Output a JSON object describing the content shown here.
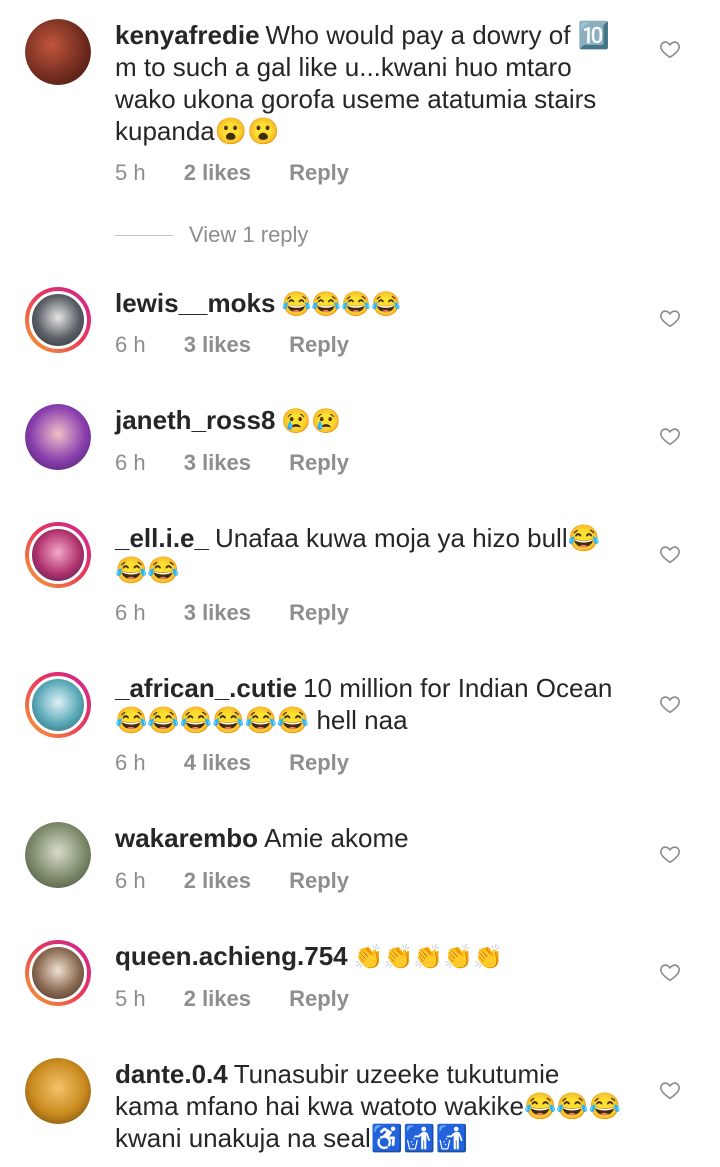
{
  "comments": [
    {
      "username": "kenyafredie",
      "text": "Who would pay a dowry of 🔟 m to such a gal like u...kwani huo mtaro wako ukona gorofa useme atatumia stairs kupanda😮😮",
      "time": "5 h",
      "likes": "2 likes",
      "reply": "Reply",
      "story_ring": false,
      "avatar_color": "#8a3b2a"
    },
    {
      "username": "lewis__moks",
      "text": "😂😂😂😂",
      "time": "6 h",
      "likes": "3 likes",
      "reply": "Reply",
      "story_ring": true,
      "avatar_color": "#3a3f46"
    },
    {
      "username": "janeth_ross8",
      "text": "😢😢",
      "time": "6 h",
      "likes": "3 likes",
      "reply": "Reply",
      "story_ring": false,
      "avatar_color": "#6b3a8c"
    },
    {
      "username": "_ell.i.e_",
      "text": "Unafaa kuwa moja ya hizo bull😂😂😂",
      "time": "6 h",
      "likes": "3 likes",
      "reply": "Reply",
      "story_ring": true,
      "avatar_color": "#b0336e"
    },
    {
      "username": "_african_.cutie",
      "text": "10 million for Indian Ocean 😂😂😂😂😂😂 hell naa",
      "time": "6 h",
      "likes": "4 likes",
      "reply": "Reply",
      "story_ring": true,
      "avatar_color": "#5aa9b8"
    },
    {
      "username": "wakarembo",
      "text": "Amie akome",
      "time": "6 h",
      "likes": "2 likes",
      "reply": "Reply",
      "story_ring": false,
      "avatar_color": "#7d8a6a"
    },
    {
      "username": "queen.achieng.754",
      "text": "👏👏👏👏👏",
      "time": "5 h",
      "likes": "2 likes",
      "reply": "Reply",
      "story_ring": true,
      "avatar_color": "#8a6a52"
    },
    {
      "username": "dante.0.4",
      "text": "Tunasubir uzeeke tukutumie kama mfano hai kwa watoto wakike😂😂😂 kwani unakuja na seal♿🚮🚮",
      "time": "",
      "likes": "",
      "reply": "",
      "story_ring": false,
      "avatar_color": "#c98a1e"
    }
  ],
  "view_replies_label": "View 1 reply",
  "icons": {
    "like": "heart-outline-icon"
  }
}
